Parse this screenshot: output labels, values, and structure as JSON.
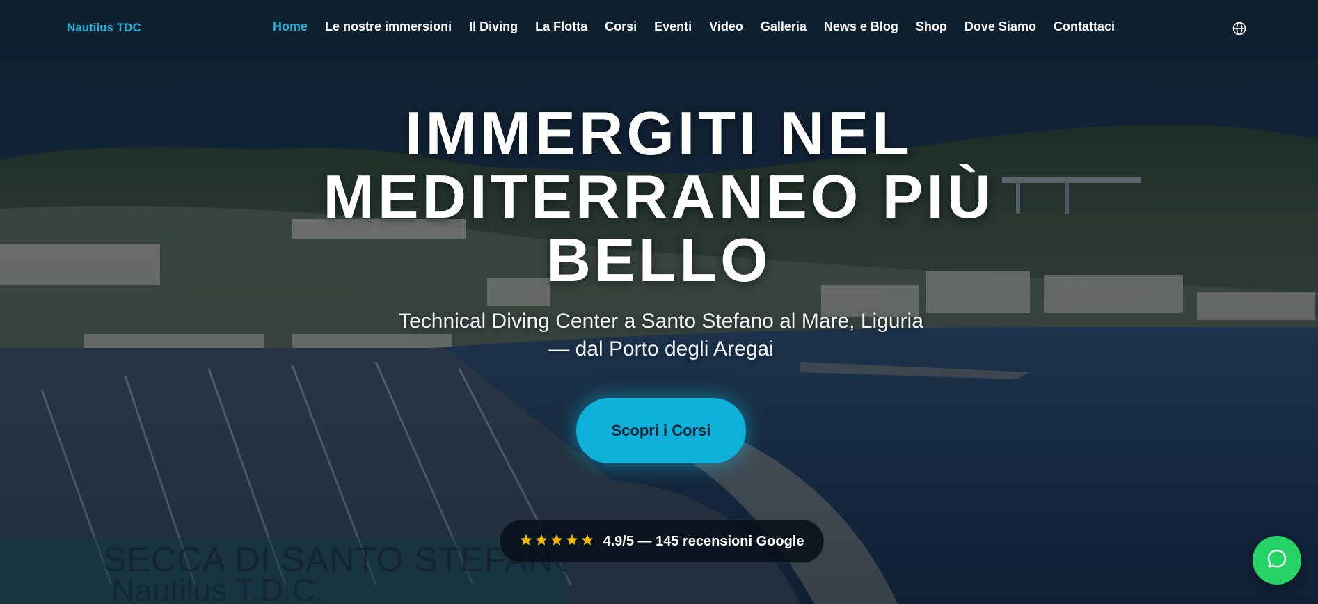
{
  "colors": {
    "accent": "#1cb4d8",
    "cta": "#0fb1d8",
    "star": "#f5b90a",
    "whatsapp": "#25d366"
  },
  "nav": {
    "brand": "Nautilus TDC",
    "items": [
      {
        "label": "Home",
        "active": true
      },
      {
        "label": "Le nostre immersioni"
      },
      {
        "label": "Il Diving"
      },
      {
        "label": "La Flotta"
      },
      {
        "label": "Corsi"
      },
      {
        "label": "Eventi"
      },
      {
        "label": "Video"
      },
      {
        "label": "Galleria"
      },
      {
        "label": "News e Blog"
      },
      {
        "label": "Shop"
      },
      {
        "label": "Dove Siamo"
      },
      {
        "label": "Contattaci"
      }
    ],
    "language_icon": "globe-icon"
  },
  "hero": {
    "title": "IMMERGITI NEL MEDITERRANEO PIÙ BELLO",
    "subtitle_line1": "Technical Diving Center a Santo Stefano al Mare, Liguria",
    "subtitle_line2": "— dal Porto degli Aregai",
    "cta_label": "Scopri i Corsi",
    "rating": {
      "stars": 5,
      "text": "4.9/5 — 145 recensioni Google",
      "icon": "star-icon"
    },
    "ghost_caption": {
      "line1": "SECCA DI SANTO STEFANO",
      "line2": "Nautilus T.D.C."
    }
  },
  "chat_button": {
    "icon": "whatsapp-chat-icon"
  }
}
